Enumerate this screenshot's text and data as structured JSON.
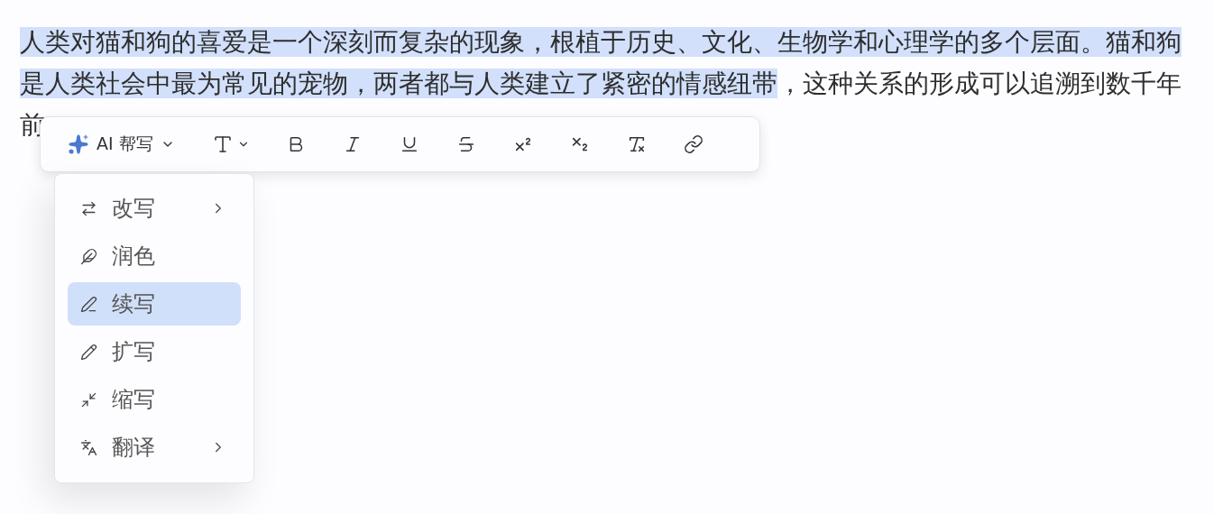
{
  "document": {
    "selected_text": "人类对猫和狗的喜爱是一个深刻而复杂的现象，根植于历史、文化、生物学和心理学的多个层面。猫和狗是人类社会中最为常见的宠物，两者都与人类建立了紧密的情感纽带",
    "rest_text": "，这种关系的形成可以追溯到数千年前"
  },
  "toolbar": {
    "ai_button": {
      "label": "AI 帮写"
    }
  },
  "ai_menu": {
    "items": [
      {
        "label": "改写",
        "submenu": true,
        "selected": false
      },
      {
        "label": "润色",
        "submenu": false,
        "selected": false
      },
      {
        "label": "续写",
        "submenu": false,
        "selected": true
      },
      {
        "label": "扩写",
        "submenu": false,
        "selected": false
      },
      {
        "label": "缩写",
        "submenu": false,
        "selected": false
      },
      {
        "label": "翻译",
        "submenu": true,
        "selected": false
      }
    ]
  }
}
